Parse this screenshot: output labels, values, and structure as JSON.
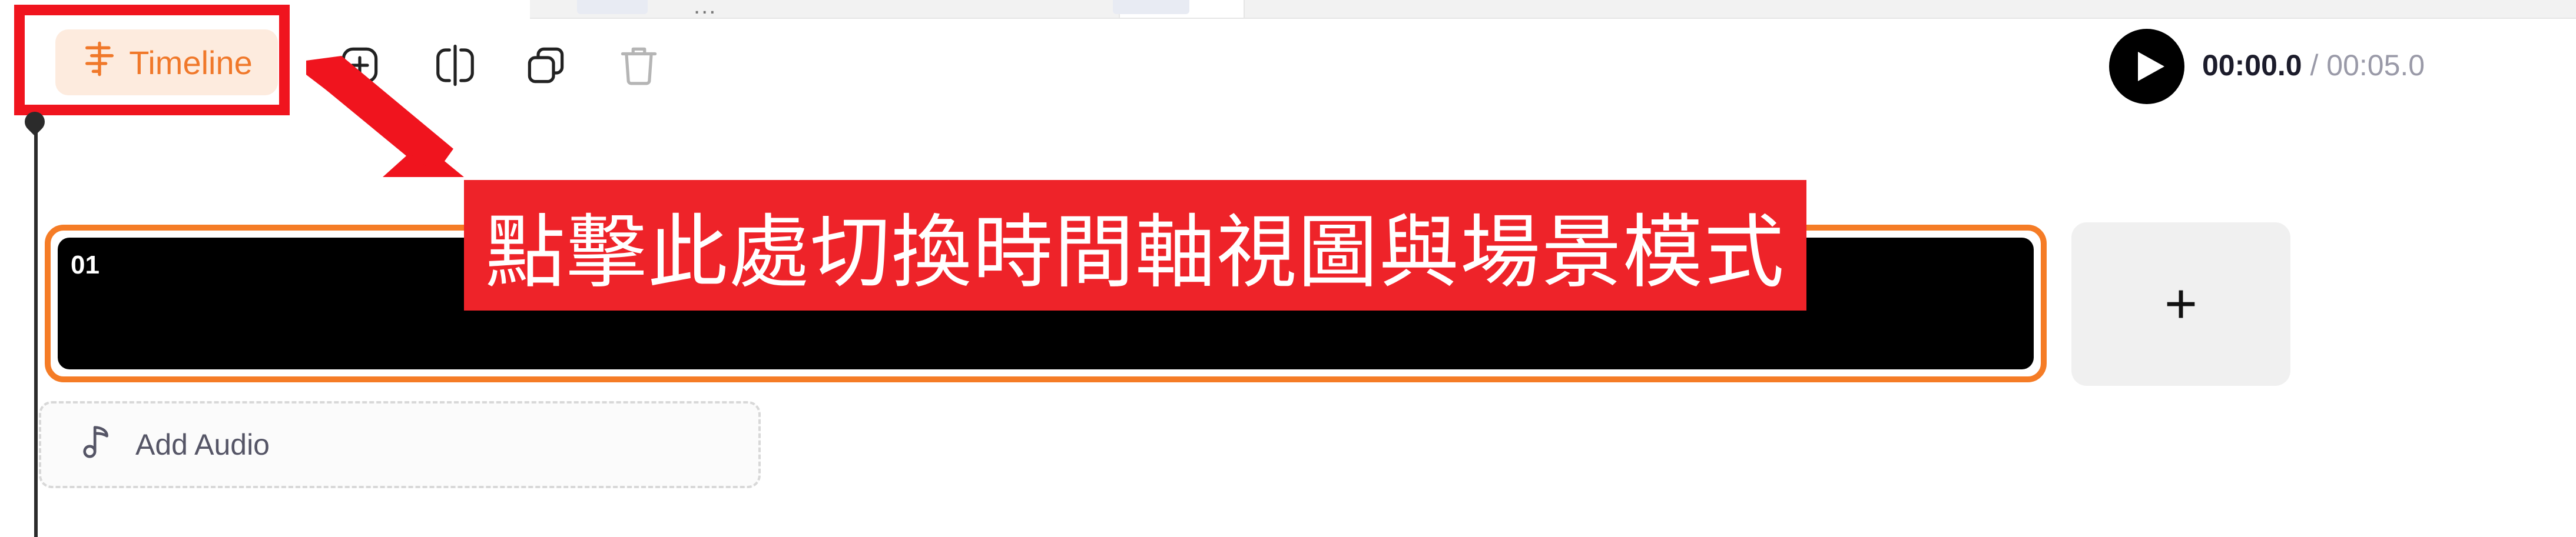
{
  "toolbar": {
    "timeline_label": "Timeline",
    "icons": [
      "timeline-icon",
      "add-icon",
      "split-icon",
      "duplicate-icon",
      "delete-icon"
    ]
  },
  "annotation": {
    "callout_text": "點擊此處切換時間軸視圖與場景模式",
    "color": "#ee2329"
  },
  "top_strip": {
    "dots": "..."
  },
  "player": {
    "current_time": "00:00.0",
    "separator": " / ",
    "total_time": "00:05.0"
  },
  "scenes": [
    {
      "number": "01"
    }
  ],
  "add_scene": {
    "label": "+"
  },
  "audio": {
    "add_label": "Add Audio"
  },
  "colors": {
    "accent": "#f57c26",
    "timeline_bg": "#fdebde",
    "timeline_text": "#f0782a",
    "annotation_red": "#f0141e"
  }
}
